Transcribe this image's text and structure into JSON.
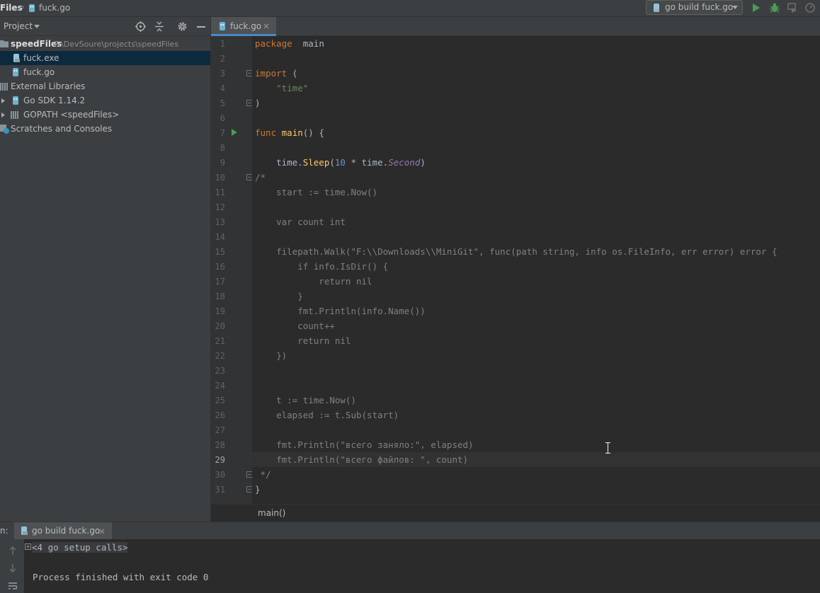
{
  "navbar": {
    "crumb_project": "Files",
    "crumb_file": "fuck.go",
    "run_config": "go build fuck.go"
  },
  "project_panel": {
    "title": "Project",
    "tree": [
      {
        "label": "speedFiles",
        "path": "F:\\DevSoure\\projects\\speedFiles",
        "icon": "folder-icon"
      },
      {
        "label": "fuck.exe",
        "icon": "file-exe-icon",
        "selected": true
      },
      {
        "label": "fuck.go",
        "icon": "go-file-icon"
      },
      {
        "label": "External Libraries",
        "icon": "library-icon"
      },
      {
        "label": "Go SDK 1.14.2",
        "icon": "go-sdk-icon"
      },
      {
        "label": "GOPATH <speedFiles>",
        "icon": "library-icon"
      },
      {
        "label": "Scratches and Consoles",
        "icon": "scratches-icon"
      }
    ]
  },
  "editor": {
    "tab": "fuck.go",
    "breadcrumb": "main()",
    "current_line": 29,
    "line_numbers": [
      "1",
      "2",
      "3",
      "4",
      "5",
      "6",
      "7",
      "8",
      "9",
      "10",
      "11",
      "12",
      "13",
      "14",
      "15",
      "16",
      "17",
      "18",
      "19",
      "20",
      "21",
      "22",
      "23",
      "24",
      "25",
      "26",
      "27",
      "28",
      "29",
      "30",
      "31"
    ],
    "lines": [
      [
        [
          "kw",
          "package"
        ],
        [
          "",
          "  main"
        ]
      ],
      [],
      [
        [
          "kw",
          "import"
        ],
        [
          "",
          " ("
        ]
      ],
      [
        [
          "",
          "    "
        ],
        [
          "str",
          "\"time\""
        ]
      ],
      [
        [
          "",
          ")"
        ]
      ],
      [],
      [
        [
          "kw",
          "func"
        ],
        [
          "",
          " "
        ],
        [
          "fn",
          "main"
        ],
        [
          "",
          "() {"
        ]
      ],
      [],
      [
        [
          "",
          "    time."
        ],
        [
          "fn",
          "Sleep"
        ],
        [
          "",
          "("
        ],
        [
          "num",
          "10"
        ],
        [
          "",
          " * time."
        ],
        [
          "it",
          "Second"
        ],
        [
          "",
          ")"
        ]
      ],
      [
        [
          "cm",
          "/*"
        ]
      ],
      [
        [
          "cm",
          "    start := time.Now()"
        ]
      ],
      [],
      [
        [
          "cm",
          "    var count int"
        ]
      ],
      [],
      [
        [
          "cm",
          "    filepath.Walk(\"F:\\\\Downloads\\\\MiniGit\", func(path string, info os.FileInfo, err error) error {"
        ]
      ],
      [
        [
          "cm",
          "        if info.IsDir() {"
        ]
      ],
      [
        [
          "cm",
          "            return nil"
        ]
      ],
      [
        [
          "cm",
          "        }"
        ]
      ],
      [
        [
          "cm",
          "        fmt.Println(info.Name())"
        ]
      ],
      [
        [
          "cm",
          "        count++"
        ]
      ],
      [
        [
          "cm",
          "        return nil"
        ]
      ],
      [
        [
          "cm",
          "    })"
        ]
      ],
      [],
      [],
      [
        [
          "cm",
          "    t := time.Now()"
        ]
      ],
      [
        [
          "cm",
          "    elapsed := t.Sub(start)"
        ]
      ],
      [],
      [
        [
          "cm",
          "    fmt.Println(\"всего заняло:\", elapsed)"
        ]
      ],
      [
        [
          "cm",
          "    fmt.Println(\"всего файлов: \", count)"
        ]
      ],
      [
        [
          "cm",
          " */"
        ]
      ],
      [
        [
          "",
          "}"
        ]
      ]
    ]
  },
  "run_panel": {
    "prefix": "n:",
    "tab": "go build fuck.go",
    "setup_calls": "<4 go setup calls>",
    "exit_message": "Process finished with exit code 0"
  }
}
